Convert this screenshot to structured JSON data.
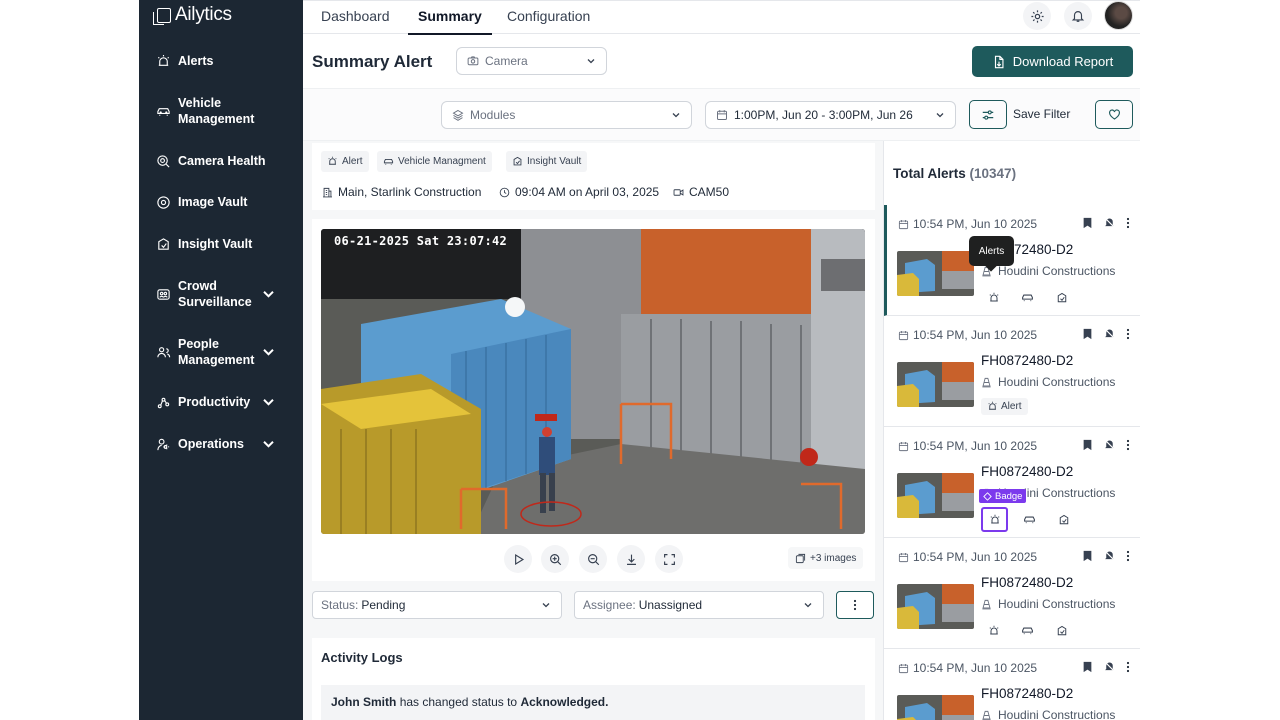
{
  "app": {
    "name": "Ailytics"
  },
  "sidebar": {
    "items": [
      {
        "label": "Alerts",
        "icon": "siren-icon",
        "expandable": false
      },
      {
        "label": "Vehicle Management",
        "icon": "car-icon",
        "expandable": false
      },
      {
        "label": "Camera Health",
        "icon": "camera-health-icon",
        "expandable": false
      },
      {
        "label": "Image Vault",
        "icon": "image-vault-icon",
        "expandable": false
      },
      {
        "label": "Insight Vault",
        "icon": "insight-vault-icon",
        "expandable": false
      },
      {
        "label": "Crowd Surveillance",
        "icon": "crowd-icon",
        "expandable": true
      },
      {
        "label": "People Management",
        "icon": "people-icon",
        "expandable": true
      },
      {
        "label": "Productivity",
        "icon": "productivity-icon",
        "expandable": true
      },
      {
        "label": "Operations",
        "icon": "operations-icon",
        "expandable": true
      }
    ]
  },
  "tabs": [
    "Dashboard",
    "Summary",
    "Configuration"
  ],
  "active_tab": "Summary",
  "header": {
    "title": "Summary Alert",
    "camera_select": "Camera",
    "download_label": "Download Report"
  },
  "filters": {
    "modules": "Modules",
    "date_range": "1:00PM, Jun 20 - 3:00PM, Jun 26",
    "save_filter": "Save Filter"
  },
  "detail": {
    "chips": [
      "Alert",
      "Vehicle Managment",
      "Insight Vault"
    ],
    "location": "Main, Starlink Construction",
    "time": "09:04 AM on April 03, 2025",
    "camera": "CAM50",
    "osd_text": "06-21-2025 Sat 23:07:42",
    "more_images": "+3 images",
    "status_label": "Status:",
    "status_value": "Pending",
    "assignee_label": "Assignee:",
    "assignee_value": "Unassigned"
  },
  "activity": {
    "title": "Activity Logs",
    "entry_user": "John Smith",
    "entry_text": "has changed status to",
    "entry_status": "Acknowledged."
  },
  "alerts_list": {
    "total_label": "Total Alerts",
    "total_count": "(10347)",
    "tooltip": "Alerts",
    "badge": "Badge",
    "chip_label": "Alert",
    "items": [
      {
        "date": "10:54 PM, Jun 10 2025",
        "id": "FH0872480-D2",
        "site": "Houdini Constructions"
      },
      {
        "date": "10:54 PM, Jun 10 2025",
        "id": "FH0872480-D2",
        "site": "Houdini Constructions"
      },
      {
        "date": "10:54 PM, Jun 10 2025",
        "id": "FH0872480-D2",
        "site": "Houdini Constructions"
      },
      {
        "date": "10:54 PM, Jun 10 2025",
        "id": "FH0872480-D2",
        "site": "Houdini Constructions"
      },
      {
        "date": "10:54 PM, Jun 10 2025",
        "id": "FH0872480-D2",
        "site": "Houdini Constructions"
      }
    ]
  },
  "colors": {
    "sidebar": "#1c2733",
    "accent": "#1e5a5c",
    "focus": "#7c3aed"
  }
}
